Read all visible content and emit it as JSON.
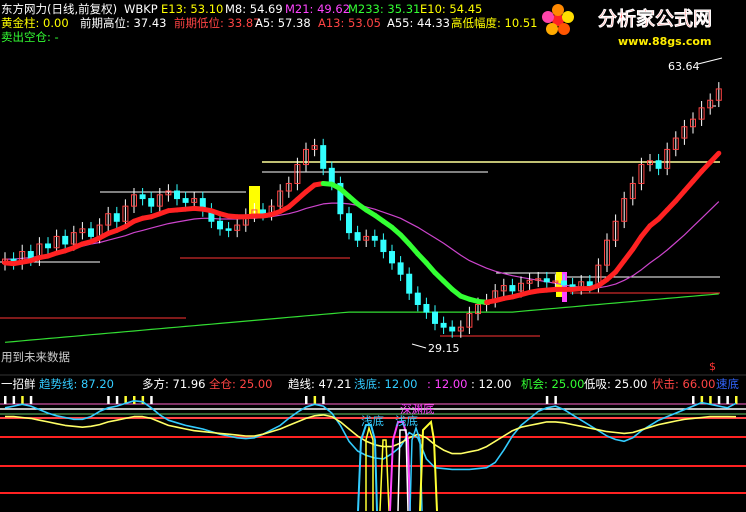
{
  "header": {
    "title": "东方网力(日线,前复权)",
    "indicator_name": "WBKP",
    "values": [
      {
        "label": "E13: 53.10",
        "color": "#ffff00"
      },
      {
        "label": "M8: 54.69",
        "color": "#ffffff"
      },
      {
        "label": "M21: 49.62",
        "color": "#ff44ff"
      },
      {
        "label": "M233: 35.31",
        "color": "#33ff33"
      },
      {
        "label": "E10: 54.45",
        "color": "#ffff00"
      }
    ]
  },
  "header2": {
    "values": [
      {
        "label": "黄金柱: 0.00",
        "color": "#ffff00"
      },
      {
        "label": "前期高位: 37.43",
        "color": "#ffffff"
      },
      {
        "label": "前期低位: 33.87",
        "color": "#ff4444"
      },
      {
        "label": "A5: 57.38",
        "color": "#ffffff"
      },
      {
        "label": "A13: 53.05",
        "color": "#ff4444"
      },
      {
        "label": "A55: 44.33",
        "color": "#ffffff"
      },
      {
        "label": "高低幅度: 10.51",
        "color": "#ffff00"
      }
    ]
  },
  "header3": {
    "label": "卖出空仓: -",
    "color": "#33ff33"
  },
  "watermark": {
    "brand": "分析家公式网",
    "url": "www.88gs.com"
  },
  "price_high_label": "63.64",
  "price_low_label": "29.15",
  "future_data_note": "用到未来数据",
  "dollar_mark": "$",
  "lower_panel": {
    "values": [
      {
        "label": "一招鲜",
        "color": "#ffffff"
      },
      {
        "label": "趋势线: 87.20",
        "color": "#33ccff"
      },
      {
        "label": "多方: 71.96",
        "color": "#ffffff"
      },
      {
        "label": "全仓: 25.00",
        "color": "#ff4444"
      },
      {
        "label": "趋线: 47.21",
        "color": "#ffffff"
      },
      {
        "label": "浅底: 12.00",
        "color": "#33ccff"
      },
      {
        "label": ": 12.00",
        "color": "#ff44ff"
      },
      {
        "label": ": 12.00",
        "color": "#ffffff"
      },
      {
        "label": "机会: 25.00",
        "color": "#33ff33"
      },
      {
        "label": "低吸: 25.00",
        "color": "#ffffff"
      },
      {
        "label": "伏击: 66.00",
        "color": "#ff4444"
      },
      {
        "label": "速底",
        "color": "#3366ff"
      }
    ],
    "annotations": [
      {
        "label": "深渊底",
        "color": "#ff44ff"
      },
      {
        "label": "浅底",
        "color": "#33ccff"
      },
      {
        "label": "浅底",
        "color": "#33ccff"
      }
    ]
  },
  "chart_data": [
    {
      "type": "candlestick",
      "title": "东方网力(日线,前复权)",
      "ylim": [
        27,
        66
      ],
      "price_high": 63.64,
      "price_low": 29.15,
      "close": [
        41,
        40.5,
        42,
        41,
        43,
        42.5,
        44,
        43,
        44.5,
        45,
        44,
        45.5,
        47,
        46,
        48,
        49.5,
        49,
        48,
        49.5,
        50,
        49,
        48.5,
        49,
        47.5,
        46,
        45,
        44.8,
        45.5,
        46.8,
        47.5,
        47,
        48,
        50,
        51,
        53.5,
        55.5,
        56,
        53,
        51,
        47,
        44.5,
        43.5,
        44,
        43.5,
        42,
        40.5,
        39,
        36.5,
        35,
        34,
        32.5,
        32,
        31.5,
        32,
        33.8,
        35,
        35.5,
        36.8,
        37.5,
        36.8,
        37.8,
        38.2,
        38.4,
        38,
        38.1,
        37.6,
        37.2,
        38,
        37.5,
        40.2,
        43.5,
        46,
        49,
        51,
        53.5,
        54,
        53,
        55.5,
        57,
        58.5,
        59.5,
        61,
        62,
        63.5
      ],
      "ma_series": [
        {
          "name": "E13",
          "color": "#ff2222",
          "values": [
            40.5,
            40.4,
            40.6,
            40.8,
            41.2,
            41.4,
            41.8,
            42.1,
            42.5,
            43,
            43.3,
            43.8,
            44.4,
            44.8,
            45.3,
            46,
            46.4,
            46.6,
            47,
            47.4,
            47.5,
            47.6,
            47.7,
            47.6,
            47.4,
            47,
            46.7,
            46.6,
            46.6,
            46.7,
            46.7,
            46.9,
            47.3,
            47.9,
            48.9,
            49.9,
            50.8,
            51,
            50.9,
            50.3,
            49.3,
            48.3,
            47.5,
            46.8,
            46,
            45.2,
            44.2,
            43,
            41.7,
            40.5,
            39.2,
            38.1,
            37,
            36.1,
            35.7,
            35.4,
            35.3,
            35.5,
            35.8,
            36,
            36.3,
            36.6,
            36.8,
            36.9,
            37,
            37,
            37,
            37.1,
            37.1,
            37.5,
            38.3,
            39.3,
            40.8,
            42.3,
            44,
            45.4,
            46.3,
            47.5,
            48.7,
            50,
            51.3,
            52.6,
            53.8,
            55
          ]
        },
        {
          "name": "M21",
          "color": "#cc44cc",
          "values": [
            41,
            41,
            41.1,
            41.2,
            41.4,
            41.6,
            41.9,
            42.1,
            42.4,
            42.7,
            43,
            43.2,
            43.5,
            43.8,
            44.1,
            44.5,
            44.8,
            45.1,
            45.4,
            45.7,
            45.9,
            46.1,
            46.3,
            46.4,
            46.4,
            46.3,
            46.3,
            46.3,
            46.4,
            46.4,
            46.5,
            46.6,
            46.8,
            47,
            47.3,
            47.7,
            48,
            48.3,
            48.4,
            48.4,
            48.3,
            48.1,
            47.9,
            47.6,
            47.2,
            46.8,
            46.4,
            45.8,
            45.2,
            44.5,
            43.8,
            43.1,
            42.3,
            41.5,
            40.8,
            40.3,
            39.8,
            39.4,
            39.1,
            38.8,
            38.6,
            38.4,
            38.2,
            38,
            37.8,
            37.6,
            37.4,
            37.3,
            37.2,
            37.2,
            37.4,
            37.7,
            38.2,
            38.8,
            39.6,
            40.5,
            41.3,
            42.2,
            43.2,
            44.2,
            45.3,
            46.4,
            47.5,
            48.6
          ]
        },
        {
          "name": "M233",
          "color": "#33dd33",
          "values": [
            30,
            30.1,
            30.2,
            30.3,
            30.4,
            30.5,
            30.6,
            30.7,
            30.8,
            30.9,
            31,
            31.1,
            31.2,
            31.3,
            31.4,
            31.5,
            31.6,
            31.7,
            31.8,
            31.9,
            32,
            32.1,
            32.2,
            32.3,
            32.4,
            32.5,
            32.6,
            32.7,
            32.8,
            32.9,
            33,
            33.1,
            33.2,
            33.3,
            33.4,
            33.5,
            33.6,
            33.7,
            33.8,
            33.9,
            34,
            34,
            34,
            34,
            34,
            34,
            34,
            34,
            34,
            34,
            34,
            34,
            34,
            34,
            34,
            34,
            34,
            34,
            34,
            34,
            34.1,
            34.2,
            34.3,
            34.4,
            34.5,
            34.6,
            34.7,
            34.8,
            34.9,
            35,
            35.1,
            35.2,
            35.3,
            35.4,
            35.5,
            35.6,
            35.7,
            35.8,
            35.9,
            36,
            36.1,
            36.2,
            36.3,
            36.4
          ]
        }
      ]
    },
    {
      "type": "line",
      "title": "一招鲜",
      "ylim": [
        0,
        100
      ],
      "series": [
        {
          "name": "趋势线",
          "color": "#33ccff",
          "values": [
            82,
            84,
            86,
            84,
            80,
            76,
            73,
            71,
            69,
            69,
            72,
            78,
            82,
            84,
            87,
            90,
            89,
            82,
            74,
            68,
            65,
            62,
            60,
            58,
            55,
            52,
            50,
            48,
            47,
            48,
            52,
            57,
            62,
            70,
            77,
            83,
            86,
            84,
            76,
            62,
            44,
            33,
            28,
            25,
            24,
            30,
            38,
            54,
            48,
            24,
            14,
            13,
            12,
            12,
            12,
            13,
            14,
            20,
            34,
            50,
            62,
            70,
            78,
            82,
            84,
            80,
            74,
            68,
            62,
            56,
            50,
            46,
            44,
            48,
            56,
            62,
            68,
            72,
            76,
            80,
            84,
            88,
            86,
            84,
            82,
            87.2
          ]
        },
        {
          "name": "多方",
          "color": "#ffff66",
          "values": [
            72,
            72,
            71,
            70,
            68,
            66,
            64,
            62,
            61,
            60,
            61,
            63,
            66,
            68,
            70,
            72,
            72,
            70,
            66,
            62,
            60,
            58,
            56,
            55,
            54,
            53,
            52,
            51,
            50,
            50,
            52,
            55,
            58,
            62,
            66,
            70,
            73,
            74,
            72,
            66,
            58,
            50,
            44,
            40,
            38,
            38,
            42,
            48,
            52,
            48,
            40,
            34,
            30,
            30,
            32,
            34,
            38,
            44,
            50,
            56,
            60,
            62,
            64,
            66,
            66,
            65,
            63,
            61,
            59,
            57,
            55,
            54,
            53,
            54,
            57,
            60,
            63,
            65,
            67,
            69,
            70,
            71,
            72,
            72,
            72,
            71.96
          ]
        }
      ]
    }
  ]
}
